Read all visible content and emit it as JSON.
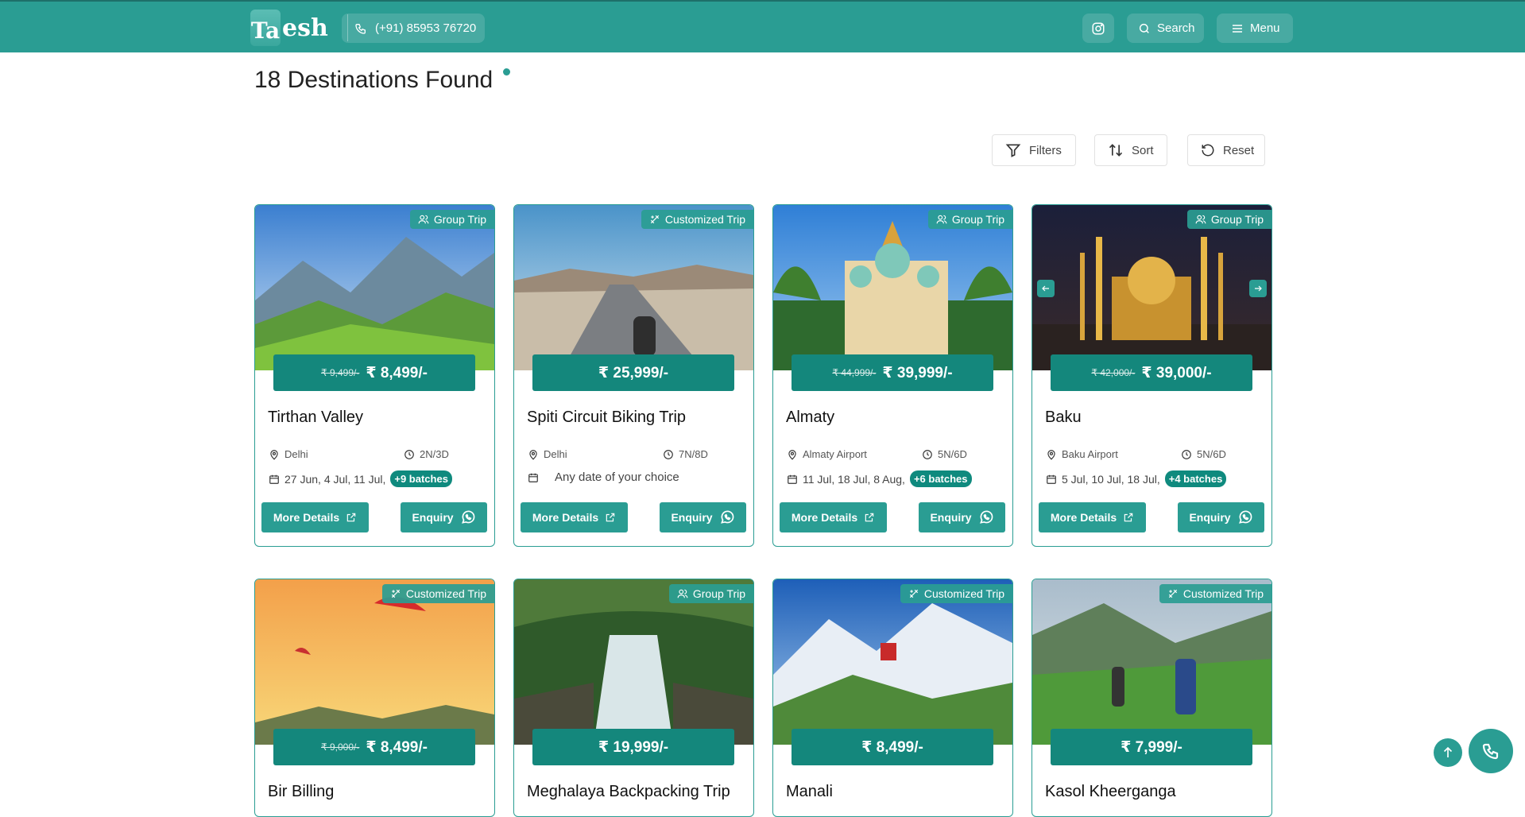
{
  "header": {
    "logo_mark": "Ta",
    "logo_text": "esh",
    "phone": "(+91) 85953 76720",
    "search_label": "Search",
    "menu_label": "Menu"
  },
  "results": {
    "heading": "18 Destinations Found"
  },
  "controls": {
    "filters": "Filters",
    "sort": "Sort",
    "reset": "Reset"
  },
  "common": {
    "more_details": "More Details",
    "enquiry": "Enquiry"
  },
  "cards": [
    {
      "badge": "Group Trip",
      "old_price": "₹ 9,499/-",
      "price": "₹ 8,499/-",
      "title": "Tirthan Valley",
      "location": "Delhi",
      "duration": "2N/3D",
      "dates": "27 Jun, 4 Jul, 11 Jul,",
      "batches": "+9 batches"
    },
    {
      "badge": "Customized Trip",
      "old_price": "",
      "price": "₹ 25,999/-",
      "title": "Spiti Circuit Biking Trip",
      "location": "Delhi",
      "duration": "7N/8D",
      "dates": "Any date of your choice",
      "batches": ""
    },
    {
      "badge": "Group Trip",
      "old_price": "₹ 44,999/-",
      "price": "₹ 39,999/-",
      "title": "Almaty",
      "location": "Almaty Airport",
      "duration": "5N/6D",
      "dates": "11 Jul, 18 Jul, 8 Aug,",
      "batches": "+6 batches"
    },
    {
      "badge": "Group Trip",
      "old_price": "₹ 42,000/-",
      "price": "₹ 39,000/-",
      "title": "Baku",
      "location": "Baku Airport",
      "duration": "5N/6D",
      "dates": "5 Jul, 10 Jul, 18 Jul,",
      "batches": "+4 batches"
    },
    {
      "badge": "Customized Trip",
      "old_price": "₹ 9,000/-",
      "price": "₹ 8,499/-",
      "title": "Bir Billing"
    },
    {
      "badge": "Group Trip",
      "old_price": "",
      "price": "₹ 19,999/-",
      "title": "Meghalaya Backpacking Trip"
    },
    {
      "badge": "Customized Trip",
      "old_price": "",
      "price": "₹ 8,499/-",
      "title": "Manali"
    },
    {
      "badge": "Customized Trip",
      "old_price": "",
      "price": "₹ 7,999/-",
      "title": "Kasol Kheerganga"
    }
  ],
  "colors": {
    "brand": "#2a9d93",
    "price_bar": "#14877c"
  }
}
